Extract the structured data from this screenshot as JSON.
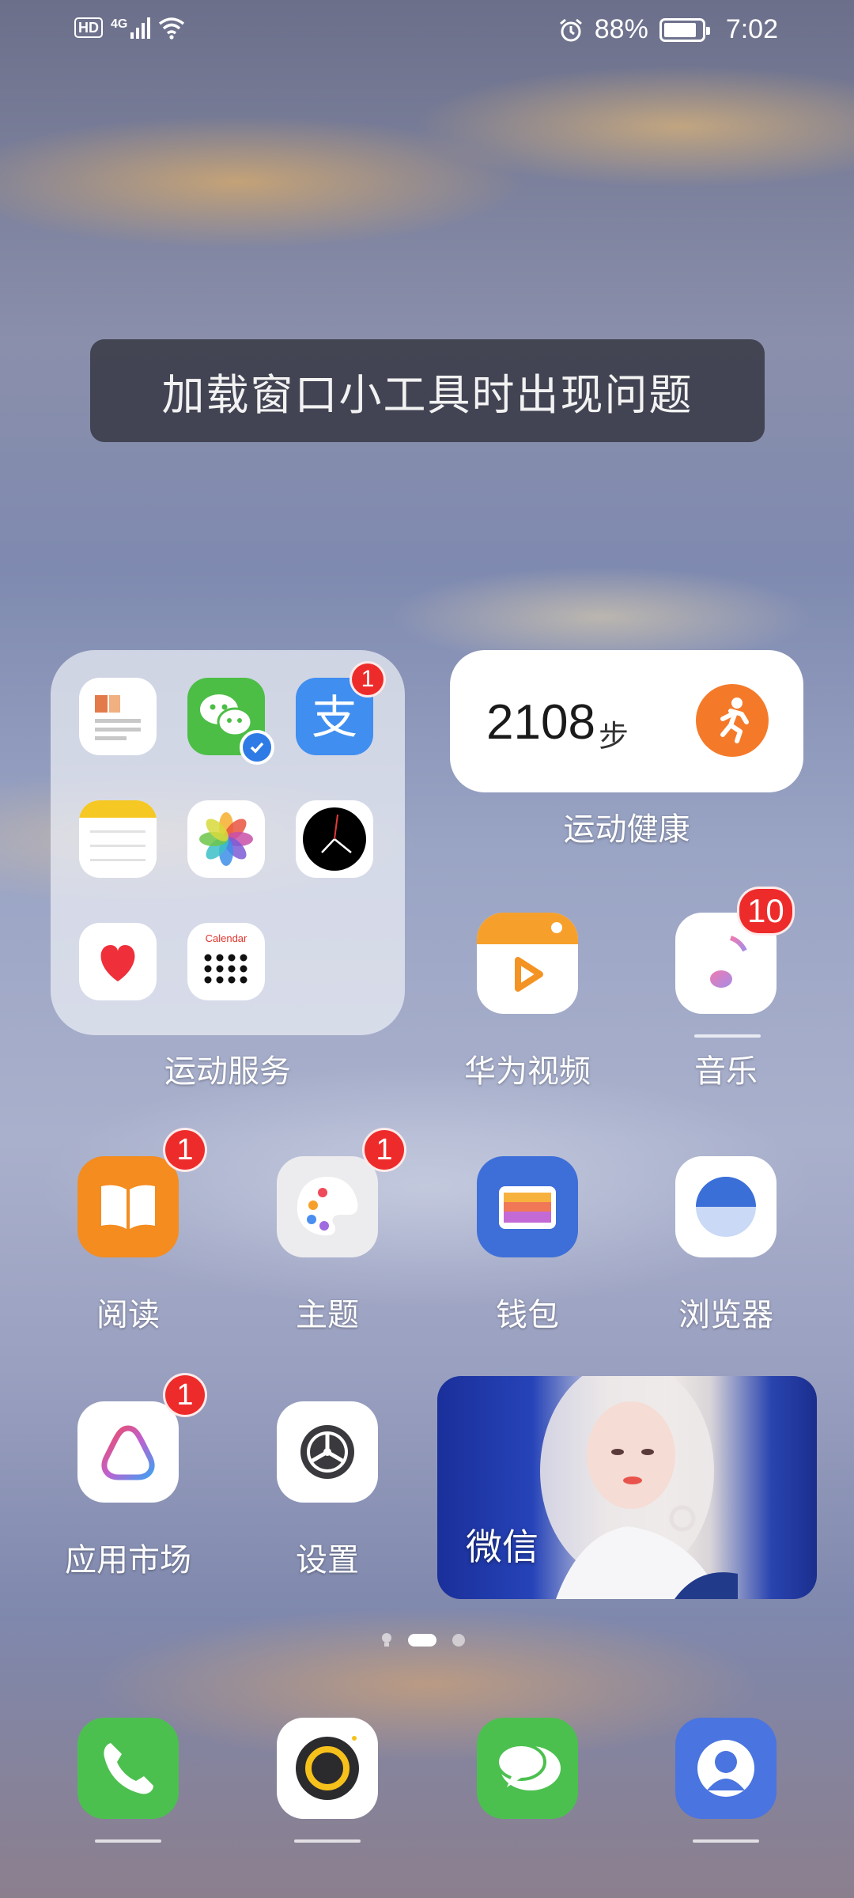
{
  "status_bar": {
    "hd": "HD",
    "network": "4G",
    "battery": "88%",
    "time": "7:02",
    "battery_level": 0.88
  },
  "toast": {
    "message": "加载窗口小工具时出现问题"
  },
  "folder": {
    "name": "运动服务",
    "apps": [
      {
        "icon": "news-icon"
      },
      {
        "icon": "wechat-icon"
      },
      {
        "icon": "alipay-icon",
        "badge": "1"
      },
      {
        "icon": "notes-icon"
      },
      {
        "icon": "photos-icon"
      },
      {
        "icon": "clock-icon"
      },
      {
        "icon": "health-heart-icon"
      },
      {
        "icon": "calendar-icon",
        "text": "Calendar"
      }
    ]
  },
  "health_widget": {
    "steps": "2108",
    "unit": "步",
    "label": "运动健康"
  },
  "apps": {
    "huawei_video": {
      "label": "华为视频"
    },
    "music": {
      "label": "音乐",
      "badge": "10"
    },
    "reading": {
      "label": "阅读",
      "badge": "1"
    },
    "themes": {
      "label": "主题",
      "badge": "1"
    },
    "wallet": {
      "label": "钱包"
    },
    "browser": {
      "label": "浏览器"
    },
    "app_market": {
      "label": "应用市场",
      "badge": "1"
    },
    "settings": {
      "label": "设置"
    }
  },
  "wechat_widget": {
    "label": "微信"
  },
  "colors": {
    "badge": "#ee2b2b",
    "run_orange": "#f47a2a",
    "phone_green": "#4cc04f",
    "contacts_blue": "#4a74e0"
  }
}
